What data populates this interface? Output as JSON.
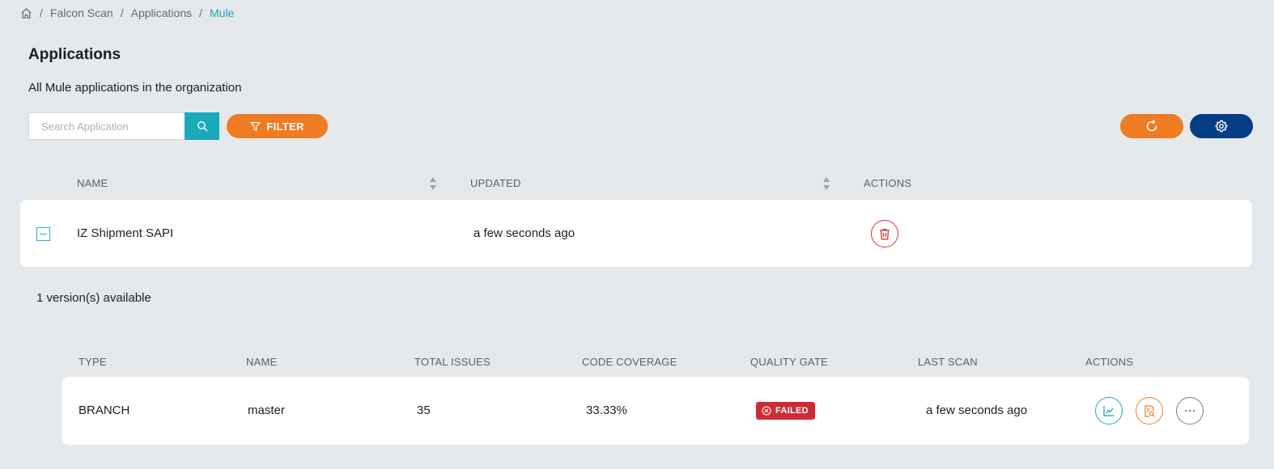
{
  "breadcrumb": {
    "items": [
      "Falcon Scan",
      "Applications"
    ],
    "current": "Mule",
    "separator": "/"
  },
  "page": {
    "title": "Applications",
    "subtitle": "All Mule applications in the organization"
  },
  "toolbar": {
    "search_placeholder": "Search Application",
    "filter_label": "FILTER"
  },
  "apps_table": {
    "columns": [
      "NAME",
      "UPDATED",
      "ACTIONS"
    ],
    "rows": [
      {
        "name": "IZ Shipment SAPI",
        "updated": "a few seconds ago"
      }
    ]
  },
  "versions": {
    "summary": "1 version(s) available",
    "columns": [
      "TYPE",
      "NAME",
      "TOTAL ISSUES",
      "CODE COVERAGE",
      "QUALITY GATE",
      "LAST SCAN",
      "ACTIONS"
    ],
    "rows": [
      {
        "type": "BRANCH",
        "name": "master",
        "total_issues": "35",
        "code_coverage": "33.33%",
        "quality_gate": "FAILED",
        "last_scan": "a few seconds ago"
      }
    ]
  },
  "colors": {
    "accent_teal": "#1aa9bb",
    "accent_orange": "#ef7b22",
    "navy": "#053d85",
    "danger": "#cf2b35",
    "background": "#e6e9ec"
  },
  "icons": [
    "home-icon",
    "search-icon",
    "filter-icon",
    "refresh-icon",
    "gear-icon",
    "sort-icon",
    "trash-icon",
    "fail-x-icon",
    "chart-icon",
    "report-search-icon",
    "more-icon"
  ]
}
